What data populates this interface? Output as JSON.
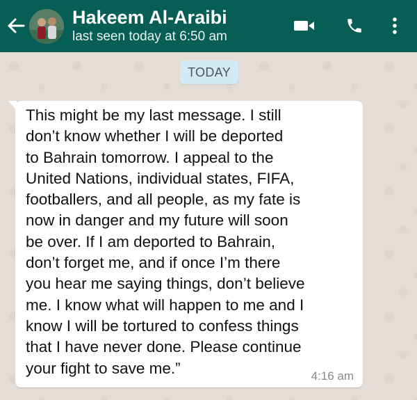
{
  "header": {
    "contact_name": "Hakeem Al-Araibi",
    "last_seen": "last seen today at 6:50 am",
    "background_color": "#075e54",
    "icons": [
      "back-arrow-icon",
      "video-call-icon",
      "phone-icon",
      "more-options-icon"
    ]
  },
  "chat": {
    "date_chip": "TODAY",
    "messages": [
      {
        "text": "This might be my last message. I still\ndon’t know whether I will be deported\nto Bahrain tomorrow. I appeal to the\nUnited Nations, individual states, FIFA,\nfootballers, and all people, as my fate is\nnow in danger and my future will soon\nbe over.  If I am deported to Bahrain,\ndon’t forget me, and if once I’m there\nyou hear me saying things, don’t believe\nme. I know what will happen to me and I\nknow I will be tortured to confess things\nthat I have never done. Please continue\nyour fight to save me.”",
        "time": "4:16 am"
      }
    ]
  }
}
